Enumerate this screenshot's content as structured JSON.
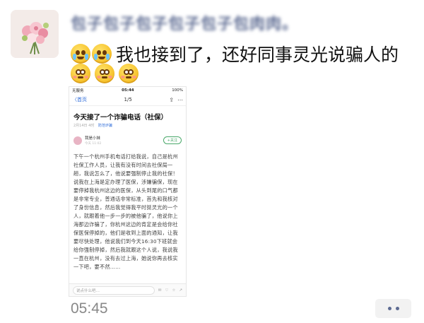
{
  "post": {
    "username": "包子包子包子包子包子包肉肉。",
    "text": "我也接到了，还好同事灵光说骗人的",
    "time": "05:45"
  },
  "emojis": {
    "line1": [
      "crying-laugh-icon",
      "crying-laugh-icon"
    ],
    "line2": [
      "flushed-icon",
      "flushed-icon",
      "flushed-icon"
    ]
  },
  "screenshot": {
    "status_bar": {
      "carrier": "无服务",
      "clock": "05:44",
      "battery": "100%"
    },
    "nav": {
      "back": "〈首页",
      "page": "1/5"
    },
    "article_title": "今天接了一个诈骗电话（社保）",
    "meta": {
      "info": "2月14日 4时",
      "tag": "防范诈骗"
    },
    "author": {
      "name": "我是小妹",
      "sub": "今天 11:02",
      "follow": "+关注"
    },
    "body": "下午一个杭州手机电话打给我说，自己是杭州社保工作人员，让我有没有时间去社保局一趟，我说怎么了，他说要强制停止我的社保！说我在上海是定办理了医保，涉嫌骗保，现在要停掉我杭州这边的医保，从头到尾的口气都是非常专业，普通话非常标准，首先和我核对了身份信息，然后我觉得我平时挺灵光的一个人，就跟着他一步一步的被他骗了，他说你上海那边诈骗了，你杭州这边的肯定是会给你社保医保停掉的，他们是收到上面的通知，让我要尽快处理，他说我们到今天16:30下班就会给你强制停掉，然后我就跟这个人说，我说我一直在杭州，没有去过上海，她说你再去核实一下吧，要不然……",
    "comment_placeholder": "说点什么吧…"
  },
  "colors": {
    "username": "#5d6b92",
    "time": "#888888",
    "link": "#2d6bd9",
    "follow": "#4aa86a"
  }
}
